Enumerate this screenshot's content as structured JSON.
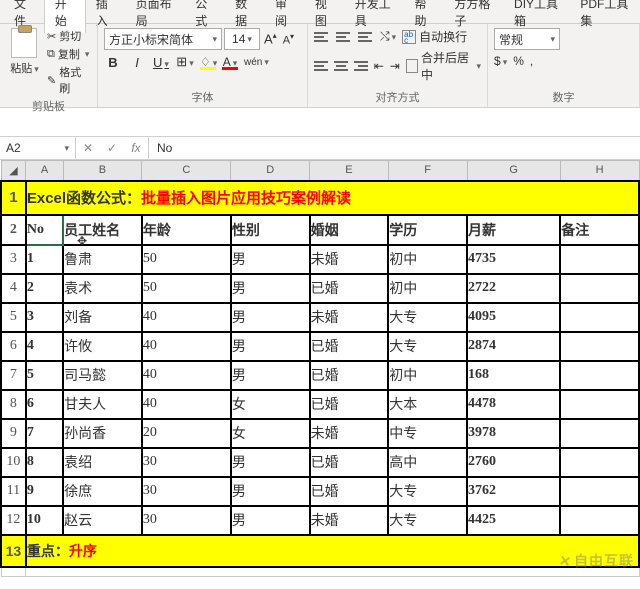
{
  "menu": {
    "file": "文件",
    "home": "开始",
    "insert": "插入",
    "layout": "页面布局",
    "formula": "公式",
    "data": "数据",
    "review": "审阅",
    "view": "视图",
    "dev": "开发工具",
    "help": "帮助",
    "fgz": "方方格子",
    "diy": "DIY工具箱",
    "pdf": "PDF工具集"
  },
  "ribbon": {
    "paste": "粘贴",
    "cut": "剪切",
    "copy": "复制",
    "fmt": "格式刷",
    "grp_clip": "剪贴板",
    "fontname": "方正小标宋简体",
    "fontsize": "14",
    "grp_font": "字体",
    "wrap": "自动换行",
    "merge": "合并后居中",
    "grp_align": "对齐方式",
    "numfmt": "常规",
    "grp_num": "数字"
  },
  "fbar": {
    "name": "A2",
    "content": "No"
  },
  "cols": [
    "A",
    "B",
    "C",
    "D",
    "E",
    "F",
    "G",
    "H"
  ],
  "title": {
    "a": "Excel函数公式：",
    "b": "批量插入图片应用技巧案例解读"
  },
  "headers": [
    "No",
    "员工姓名",
    "年龄",
    "性别",
    "婚姻",
    "学历",
    "月薪",
    "备注"
  ],
  "rows": [
    {
      "no": "1",
      "name": "鲁肃",
      "age": "50",
      "sex": "男",
      "mar": "未婚",
      "edu": "初中",
      "sal": "4735",
      "note": ""
    },
    {
      "no": "2",
      "name": "袁术",
      "age": "50",
      "sex": "男",
      "mar": "已婚",
      "edu": "初中",
      "sal": "2722",
      "note": ""
    },
    {
      "no": "3",
      "name": "刘备",
      "age": "40",
      "sex": "男",
      "mar": "未婚",
      "edu": "大专",
      "sal": "4095",
      "note": ""
    },
    {
      "no": "4",
      "name": "许攸",
      "age": "40",
      "sex": "男",
      "mar": "已婚",
      "edu": "大专",
      "sal": "2874",
      "note": ""
    },
    {
      "no": "5",
      "name": "司马懿",
      "age": "40",
      "sex": "男",
      "mar": "已婚",
      "edu": "初中",
      "sal": "168",
      "note": ""
    },
    {
      "no": "6",
      "name": "甘夫人",
      "age": "40",
      "sex": "女",
      "mar": "已婚",
      "edu": "大本",
      "sal": "4478",
      "note": ""
    },
    {
      "no": "7",
      "name": "孙尚香",
      "age": "20",
      "sex": "女",
      "mar": "未婚",
      "edu": "中专",
      "sal": "3978",
      "note": ""
    },
    {
      "no": "8",
      "name": "袁绍",
      "age": "30",
      "sex": "男",
      "mar": "已婚",
      "edu": "高中",
      "sal": "2760",
      "note": ""
    },
    {
      "no": "9",
      "name": "徐庶",
      "age": "30",
      "sex": "男",
      "mar": "已婚",
      "edu": "大专",
      "sal": "3762",
      "note": ""
    },
    {
      "no": "10",
      "name": "赵云",
      "age": "30",
      "sex": "男",
      "mar": "未婚",
      "edu": "大专",
      "sal": "4425",
      "note": ""
    }
  ],
  "footer": {
    "a": "重点：",
    "b": "升序"
  },
  "watermark": "自由互联"
}
